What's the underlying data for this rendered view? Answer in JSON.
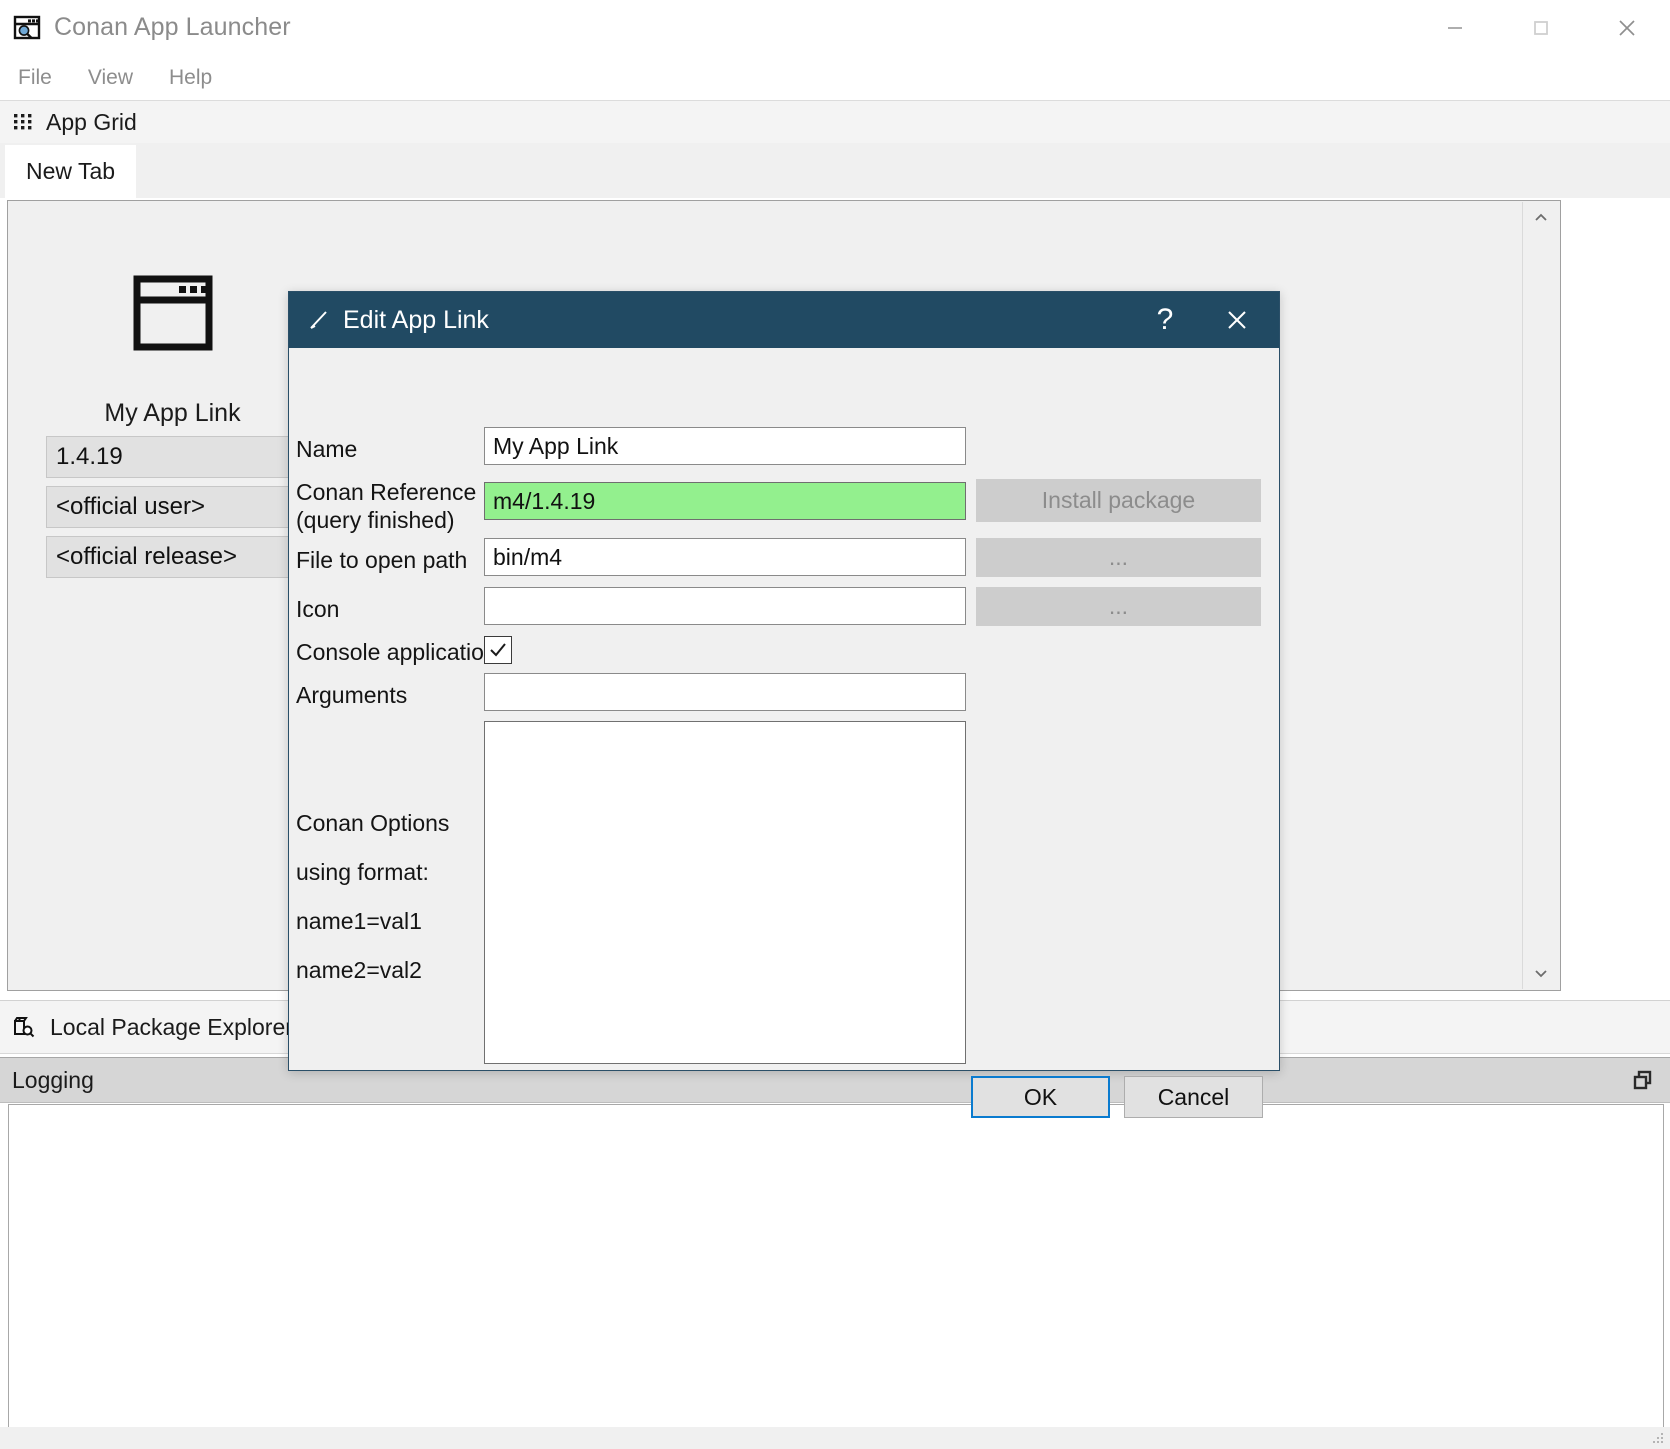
{
  "window": {
    "title": "Conan App Launcher",
    "icon": "conan-search-window-icon",
    "controls": {
      "minimize": "minimize-icon",
      "maximize": "maximize-icon",
      "close": "close-icon"
    }
  },
  "menubar": {
    "items": [
      {
        "label": "File",
        "name": "menu-file"
      },
      {
        "label": "View",
        "name": "menu-view"
      },
      {
        "label": "Help",
        "name": "menu-help"
      }
    ]
  },
  "gridbar": {
    "icon": "grid-dots-icon",
    "label": "App Grid"
  },
  "tabs": [
    {
      "label": "New Tab",
      "active": true
    }
  ],
  "app_tile": {
    "icon": "application-window-icon",
    "name": "My App Link",
    "version": "1.4.19",
    "user": "<official user>",
    "channel": "<official release>"
  },
  "scrollbar": {
    "up": "chevron-up-icon",
    "down": "chevron-down-icon"
  },
  "local_package_explorer": {
    "icon": "package-search-icon",
    "label": "Local Package Explorer"
  },
  "logging": {
    "title": "Logging",
    "float_icon": "float-window-icon",
    "content": ""
  },
  "dialog": {
    "title": "Edit App Link",
    "title_icon": "pencil-edit-icon",
    "help_label": "?",
    "close_icon": "close-icon",
    "fields": {
      "name": {
        "label": "Name",
        "value": "My App Link",
        "placeholder": ""
      },
      "conan_reference": {
        "label_line1": "Conan Reference",
        "label_line2": "(query finished)",
        "value": "m4/1.4.19",
        "placeholder": "",
        "status_color": "#93f08e",
        "button": "Install package"
      },
      "file_to_open_path": {
        "label": "File to open path",
        "value": "bin/m4",
        "placeholder": "",
        "button": "..."
      },
      "icon": {
        "label": "Icon",
        "value": "",
        "placeholder": "",
        "button": "..."
      },
      "console_application": {
        "label": "Console application",
        "checked": true,
        "check_glyph": "✓"
      },
      "arguments": {
        "label": "Arguments",
        "value": "",
        "placeholder": ""
      },
      "conan_options": {
        "label_line1": "Conan Options",
        "label_line2": "using format:",
        "label_line3": "name1=val1",
        "label_line4": "name2=val2",
        "value": ""
      }
    },
    "buttons": {
      "ok": "OK",
      "cancel": "Cancel"
    }
  },
  "colors": {
    "dialog_title_bg": "#214a63",
    "accent_focus": "#0a7bcf",
    "status_ok_green": "#93f08e",
    "window_chrome": "#f0f0f0"
  }
}
